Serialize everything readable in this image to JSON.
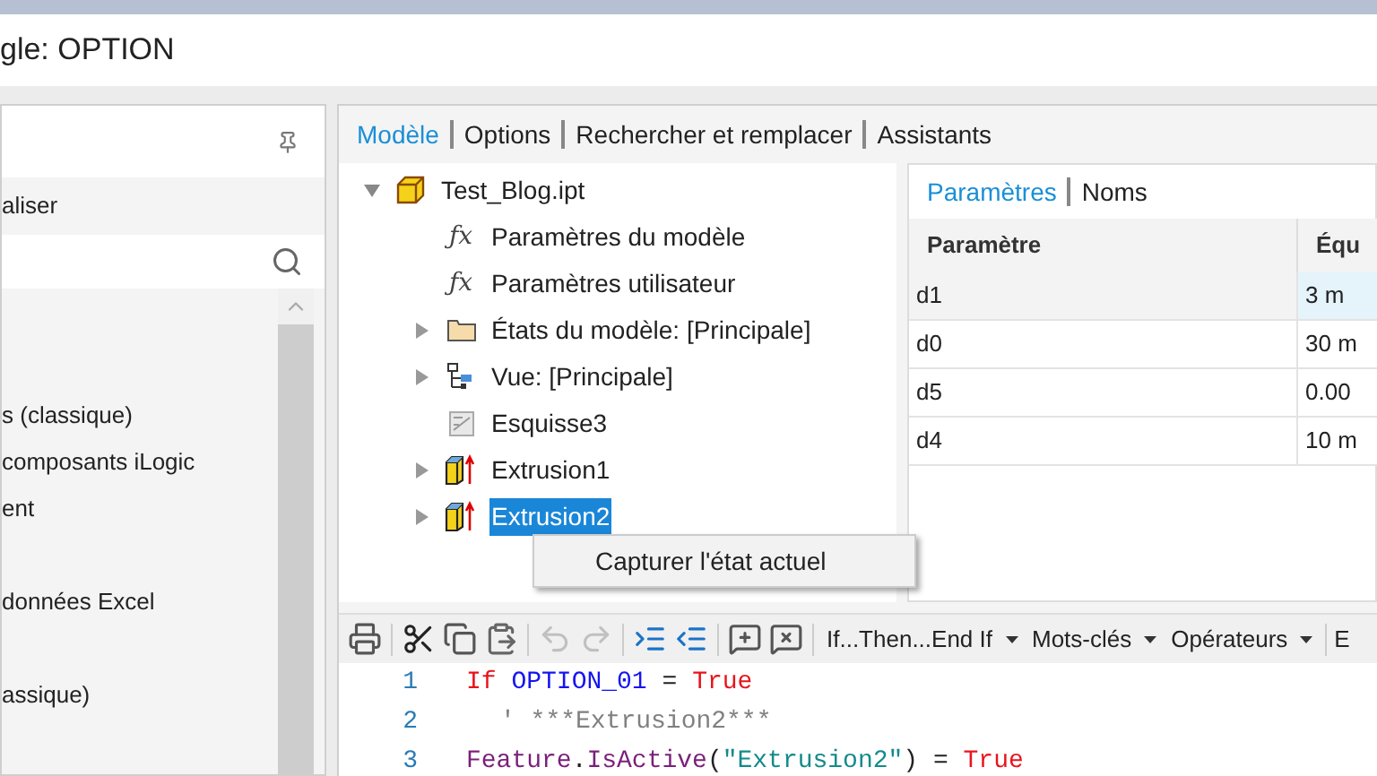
{
  "window": {
    "title": "gle: OPTION"
  },
  "left_panel": {
    "header_item": "aliser",
    "items": [
      "s (classique)",
      "composants iLogic",
      "ent",
      "données Excel",
      "assique)"
    ]
  },
  "tabs": [
    {
      "label": "Modèle",
      "selected": true
    },
    {
      "label": "Options",
      "selected": false
    },
    {
      "label": "Rechercher et remplacer",
      "selected": false
    },
    {
      "label": "Assistants",
      "selected": false
    }
  ],
  "tree": [
    {
      "label": "Test_Blog.ipt",
      "kind": "part",
      "expanded": true,
      "selected": false,
      "children": [
        {
          "label": "Paramètres du modèle",
          "kind": "parameters",
          "symbol": "ƒx",
          "selected": false
        },
        {
          "label": "Paramètres utilisateur",
          "kind": "parameters",
          "symbol": "ƒx",
          "selected": false
        },
        {
          "label": "États du modèle: [Principale]",
          "kind": "folder",
          "expanded": false,
          "selected": false
        },
        {
          "label": "Vue: [Principale]",
          "kind": "view",
          "expanded": false,
          "selected": false
        },
        {
          "label": "Esquisse3",
          "kind": "sketch",
          "selected": false
        },
        {
          "label": "Extrusion1",
          "kind": "extrusion",
          "expanded": false,
          "selected": false
        },
        {
          "label": "Extrusion2",
          "kind": "extrusion",
          "expanded": false,
          "selected": true
        }
      ]
    }
  ],
  "context_menu": {
    "items": [
      "Capturer l'état actuel"
    ]
  },
  "param_tabs": [
    {
      "label": "Paramètres",
      "selected": true
    },
    {
      "label": "Noms",
      "selected": false
    }
  ],
  "table": {
    "columns": [
      "Paramètre",
      "Équ"
    ],
    "rows": [
      {
        "cells": [
          "d1",
          "3 m"
        ],
        "selected": true
      },
      {
        "cells": [
          "d0",
          "30 m"
        ],
        "selected": false
      },
      {
        "cells": [
          "d5",
          "0.00"
        ],
        "selected": false
      },
      {
        "cells": [
          "d4",
          "10 m"
        ],
        "selected": false
      }
    ]
  },
  "toolbar": {
    "icons": [
      {
        "kind": "print",
        "disabled": false
      },
      {
        "kind": "cut",
        "disabled": false
      },
      {
        "kind": "copy",
        "disabled": false
      },
      {
        "kind": "paste",
        "disabled": false
      },
      {
        "kind": "undo",
        "disabled": true
      },
      {
        "kind": "redo",
        "disabled": true
      },
      {
        "kind": "indent",
        "disabled": false
      },
      {
        "kind": "outdent",
        "disabled": false
      },
      {
        "kind": "comment-add",
        "disabled": false
      },
      {
        "kind": "comment-remove",
        "disabled": false
      }
    ],
    "menus": [
      "If...Then...End If",
      "Mots-clés",
      "Opérateurs"
    ],
    "cut_label": "E"
  },
  "code": [
    {
      "number": "1",
      "indent": false,
      "tokens": [
        {
          "text": "If ",
          "kind": "keyword"
        },
        {
          "text": "OPTION_01",
          "kind": "variable"
        },
        {
          "text": " = ",
          "kind": "plain"
        },
        {
          "text": "True",
          "kind": "keyword"
        }
      ]
    },
    {
      "number": "2",
      "indent": true,
      "tokens": [
        {
          "text": "' ***Extrusion2***",
          "kind": "comment"
        }
      ]
    },
    {
      "number": "3",
      "indent": false,
      "tokens": [
        {
          "text": "Feature",
          "kind": "method"
        },
        {
          "text": ".",
          "kind": "plain"
        },
        {
          "text": "IsActive",
          "kind": "method"
        },
        {
          "text": "(",
          "kind": "plain"
        },
        {
          "text": "\"Extrusion2\"",
          "kind": "string"
        },
        {
          "text": ") = ",
          "kind": "plain"
        },
        {
          "text": "True",
          "kind": "keyword"
        }
      ]
    }
  ]
}
